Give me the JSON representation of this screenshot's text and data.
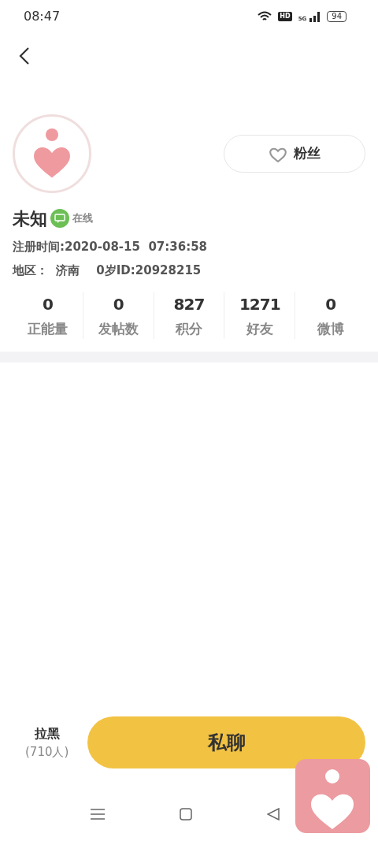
{
  "status_bar": {
    "time": "08:47",
    "hd": "HD",
    "network": "5G",
    "battery": "94"
  },
  "profile": {
    "fans_button": "粉丝",
    "name": "未知",
    "online": true,
    "online_label": "在线",
    "registered": "注册时间:2020-08-15  07:36:58",
    "region_line": "地区：  济南    0岁ID:20928215"
  },
  "stats": [
    {
      "value": "0",
      "label": "正能量"
    },
    {
      "value": "0",
      "label": "发帖数"
    },
    {
      "value": "827",
      "label": "积分"
    },
    {
      "value": "1271",
      "label": "好友"
    },
    {
      "value": "0",
      "label": "微博"
    }
  ],
  "bottom_bar": {
    "block_label": "拉黑",
    "block_count": "(710人)",
    "chat_button": "私聊"
  }
}
